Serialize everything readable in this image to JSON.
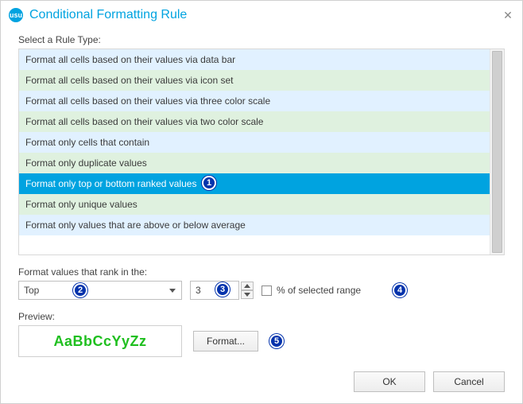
{
  "title": "Conditional Formatting Rule",
  "labels": {
    "selectRuleType": "Select a Rule Type:",
    "rankIn": "Format values that rank in the:",
    "preview": "Preview:",
    "percentOfRange": "% of selected range"
  },
  "ruleTypes": [
    "Format all cells based on their values via data bar",
    "Format all cells based on their values via icon set",
    "Format all cells based on their values via three color scale",
    "Format all cells based on their values via two color scale",
    "Format only cells that contain",
    "Format only duplicate values",
    "Format only top or bottom ranked values",
    "Format only unique values",
    "Format only values that are above or below average"
  ],
  "selectedRuleIndex": 6,
  "rank": {
    "direction": "Top",
    "count": "3"
  },
  "previewText": "AaBbCcYyZz",
  "buttons": {
    "format": "Format...",
    "ok": "OK",
    "cancel": "Cancel"
  },
  "annotations": {
    "a1": "1",
    "a2": "2",
    "a3": "3",
    "a4": "4",
    "a5": "5"
  }
}
